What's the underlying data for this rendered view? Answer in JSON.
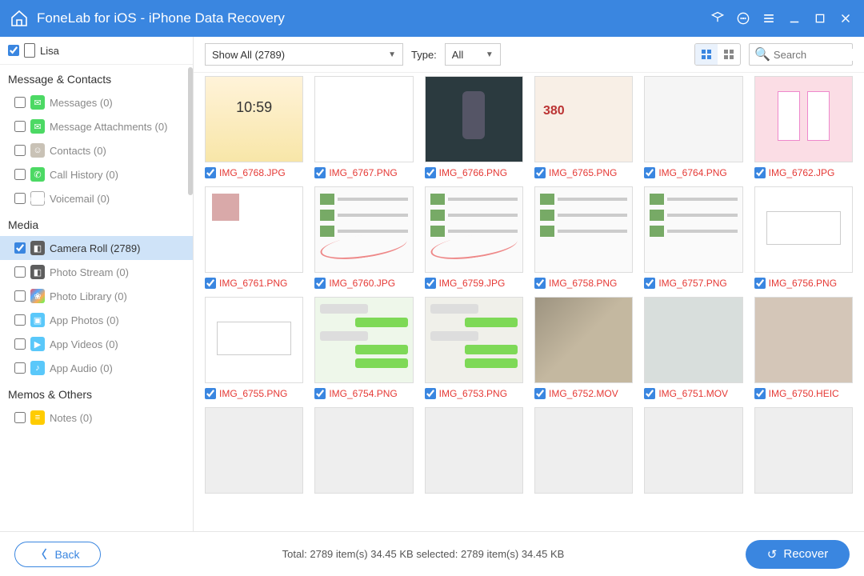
{
  "titlebar": {
    "title": "FoneLab for iOS - iPhone Data Recovery"
  },
  "device": {
    "name": "Lisa"
  },
  "sections": {
    "msgs": "Message & Contacts",
    "media": "Media",
    "memos": "Memos & Others"
  },
  "sidebar": {
    "messages": "Messages (0)",
    "attachments": "Message Attachments (0)",
    "contacts": "Contacts (0)",
    "callhistory": "Call History (0)",
    "voicemail": "Voicemail (0)",
    "cameraroll": "Camera Roll (2789)",
    "photostream": "Photo Stream (0)",
    "photolibrary": "Photo Library (0)",
    "appphotos": "App Photos (0)",
    "appvideos": "App Videos (0)",
    "appaudio": "App Audio (0)",
    "notes": "Notes (0)"
  },
  "toolbar": {
    "filter": "Show All (2789)",
    "type_label": "Type:",
    "type_value": "All",
    "search_placeholder": "Search"
  },
  "grid": [
    {
      "filename": "IMG_6768.JPG",
      "th": "th-a"
    },
    {
      "filename": "IMG_6767.PNG",
      "th": "th-b"
    },
    {
      "filename": "IMG_6766.PNG",
      "th": "th-c"
    },
    {
      "filename": "IMG_6765.PNG",
      "th": "th-d"
    },
    {
      "filename": "IMG_6764.PNG",
      "th": "th-e"
    },
    {
      "filename": "IMG_6762.JPG",
      "th": "th-f"
    },
    {
      "filename": "IMG_6761.PNG",
      "th": "th-g"
    },
    {
      "filename": "IMG_6760.JPG",
      "th": "th-h"
    },
    {
      "filename": "IMG_6759.JPG",
      "th": "th-i"
    },
    {
      "filename": "IMG_6758.PNG",
      "th": "th-j"
    },
    {
      "filename": "IMG_6757.PNG",
      "th": "th-k"
    },
    {
      "filename": "IMG_6756.PNG",
      "th": "th-l"
    },
    {
      "filename": "IMG_6755.PNG",
      "th": "th-m"
    },
    {
      "filename": "IMG_6754.PNG",
      "th": "th-n"
    },
    {
      "filename": "IMG_6753.PNG",
      "th": "th-o"
    },
    {
      "filename": "IMG_6752.MOV",
      "th": "th-p"
    },
    {
      "filename": "IMG_6751.MOV",
      "th": "th-q"
    },
    {
      "filename": "IMG_6750.HEIC",
      "th": "th-r"
    },
    {
      "filename": "",
      "th": "th-s"
    },
    {
      "filename": "",
      "th": "th-t"
    },
    {
      "filename": "",
      "th": "th-u"
    },
    {
      "filename": "",
      "th": "th-v"
    },
    {
      "filename": "",
      "th": "th-w"
    },
    {
      "filename": "",
      "th": "th-x"
    }
  ],
  "footer": {
    "back": "Back",
    "stats": "Total: 2789 item(s) 34.45 KB   selected: 2789 item(s) 34.45 KB",
    "recover": "Recover"
  }
}
